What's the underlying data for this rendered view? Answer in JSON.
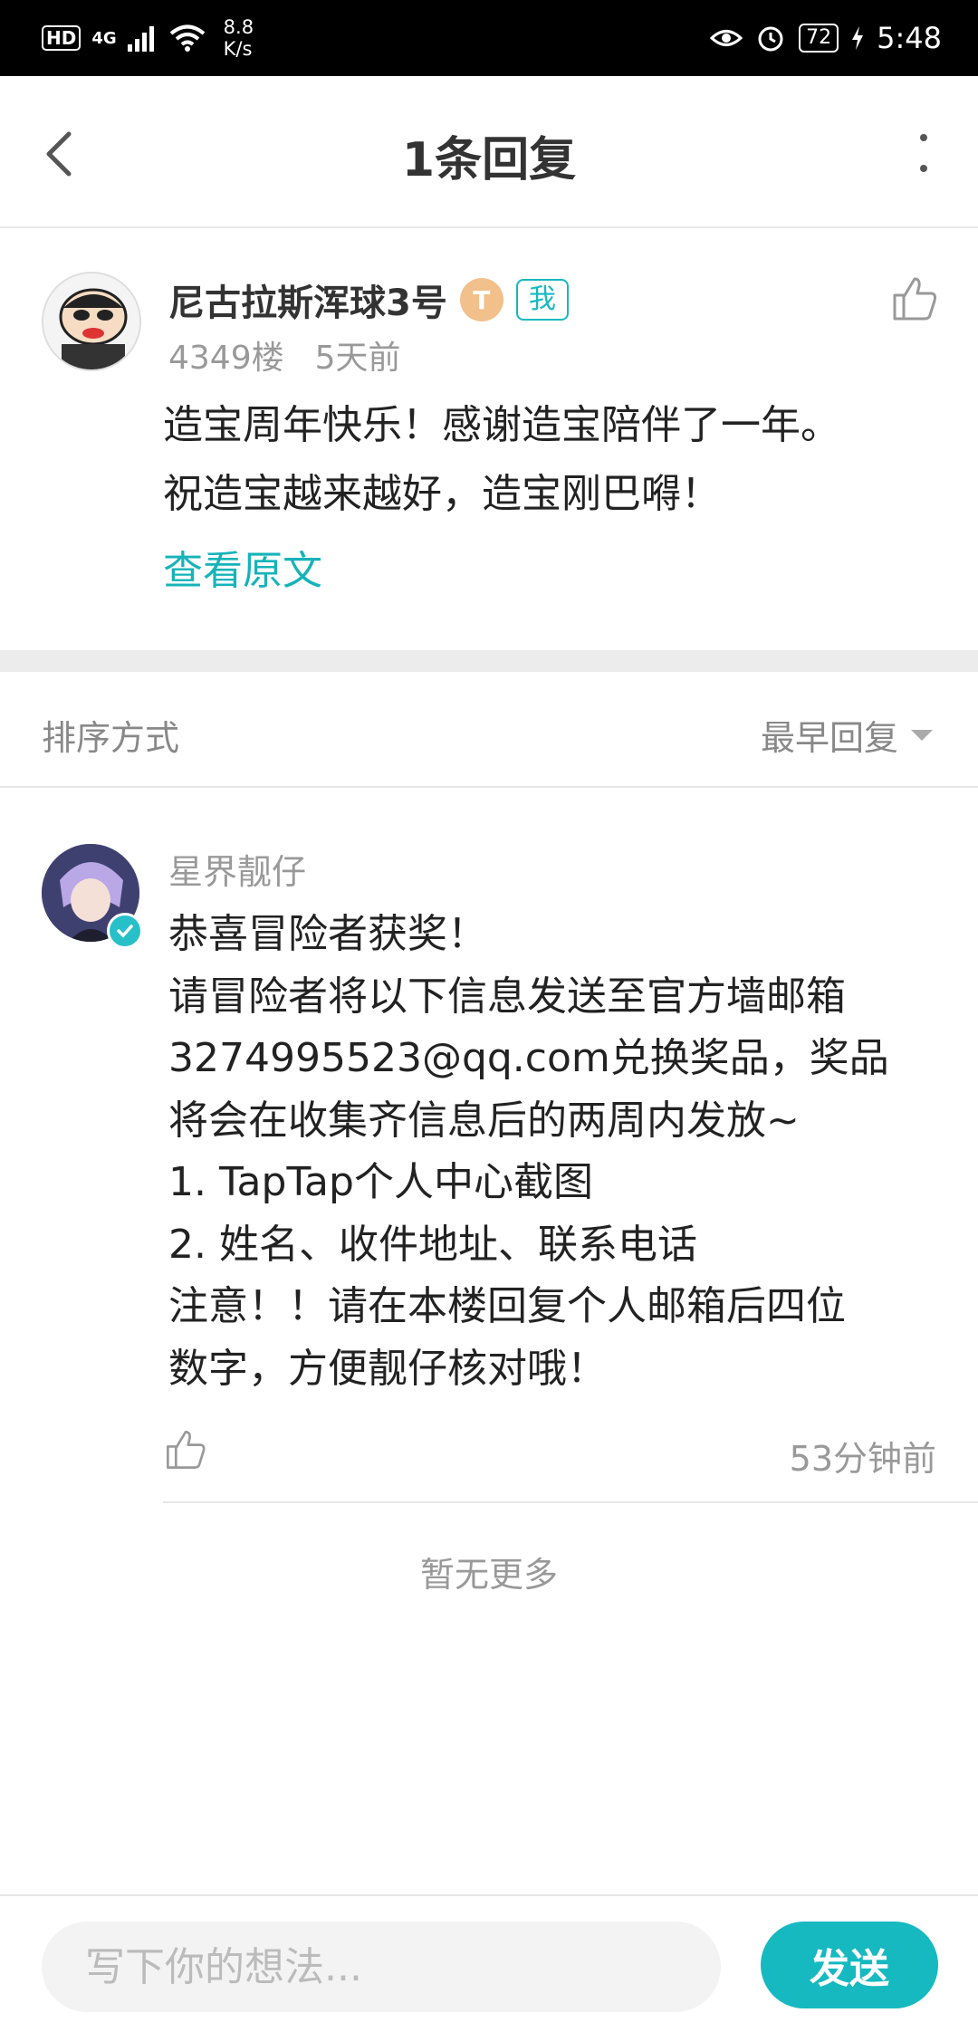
{
  "status_bar": {
    "hd": "HD",
    "network": "4G",
    "speed_value": "8.8",
    "speed_unit": "K/s",
    "battery": "72",
    "time": "5:48"
  },
  "header": {
    "title": "1条回复"
  },
  "original_post": {
    "username": "尼古拉斯浑球3号",
    "level_badge": "T",
    "me_badge": "我",
    "floor": "4349楼",
    "time": "5天前",
    "content_lines": [
      "造宝周年快乐！感谢造宝陪伴了一年。",
      "祝造宝越来越好，造宝刚巴嘚！"
    ],
    "view_original": "查看原文"
  },
  "sort": {
    "label": "排序方式",
    "selected": "最早回复"
  },
  "reply": {
    "username": "星界靓仔",
    "lines": [
      "恭喜冒险者获奖！",
      "请冒险者将以下信息发送至官方墙邮箱",
      "3274995523@qq.com兑换奖品，奖品",
      "将会在收集齐信息后的两周内发放~",
      "1. TapTap个人中心截图",
      "2. 姓名、收件地址、联系电话",
      "注意！！请在本楼回复个人邮箱后四位",
      "数字，方便靓仔核对哦！"
    ],
    "time": "53分钟前"
  },
  "footer_note": "暂无更多",
  "composer": {
    "placeholder": "写下你的想法...",
    "send_label": "发送"
  },
  "colors": {
    "accent": "#16b9c0",
    "link": "#16b3b9"
  }
}
